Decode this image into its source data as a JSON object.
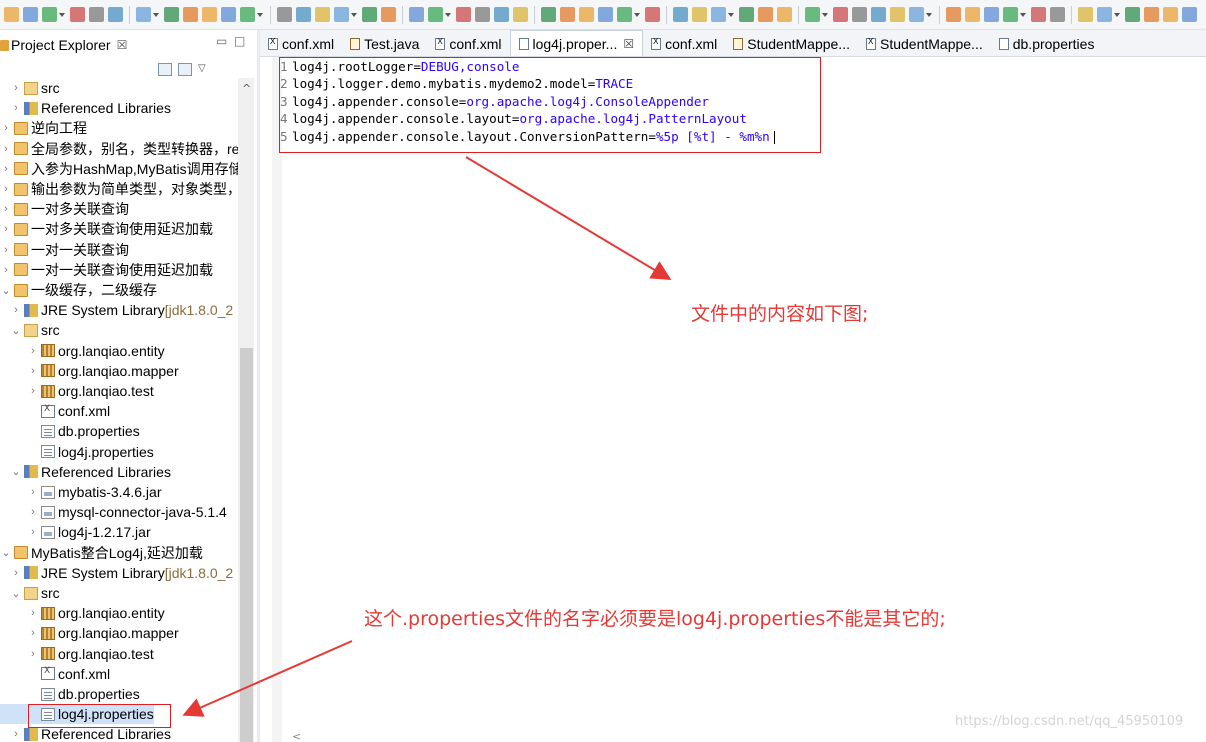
{
  "colors": {
    "annotation_red": "#e53935",
    "value_blue": "#2a00ff",
    "selection": "#ffffff"
  },
  "toolbar": {
    "icons": [
      "new-icon",
      "save-icon",
      "save-all-icon",
      "run-icon",
      "debug-icon",
      "search-icon",
      "perspective-icon"
    ]
  },
  "explorer": {
    "title": "Project Explorer",
    "close_glyph": "☒",
    "minimize_glyph": "▭",
    "maximize_glyph": "□",
    "tree": [
      {
        "label": "src",
        "indent": 1,
        "chev": ">",
        "icon": "src"
      },
      {
        "label": "Referenced Libraries",
        "indent": 1,
        "chev": ">",
        "icon": "lib"
      },
      {
        "label": "逆向工程",
        "indent": 0,
        "chev": ">",
        "icon": "proj"
      },
      {
        "label": "全局参数，别名，类型转换器，resu",
        "indent": 0,
        "chev": ">",
        "icon": "proj"
      },
      {
        "label": "入参为HashMap,MyBatis调用存储",
        "indent": 0,
        "chev": ">",
        "icon": "proj"
      },
      {
        "label": "输出参数为简单类型，对象类型，H",
        "indent": 0,
        "chev": ">",
        "icon": "proj"
      },
      {
        "label": "一对多关联查询",
        "indent": 0,
        "chev": ">",
        "icon": "proj"
      },
      {
        "label": "一对多关联查询使用延迟加载",
        "indent": 0,
        "chev": ">",
        "icon": "proj"
      },
      {
        "label": "一对一关联查询",
        "indent": 0,
        "chev": ">",
        "icon": "proj"
      },
      {
        "label": "一对一关联查询使用延迟加载",
        "indent": 0,
        "chev": ">",
        "icon": "proj"
      },
      {
        "label": "一级缓存，二级缓存",
        "indent": 0,
        "chev": "v",
        "icon": "proj"
      },
      {
        "label": "JRE System Library",
        "suffix": " [jdk1.8.0_2",
        "indent": 1,
        "chev": ">",
        "icon": "lib"
      },
      {
        "label": "src",
        "indent": 1,
        "chev": "v",
        "icon": "src"
      },
      {
        "label": "org.lanqiao.entity",
        "indent": 2,
        "chev": ">",
        "icon": "pkg"
      },
      {
        "label": "org.lanqiao.mapper",
        "indent": 2,
        "chev": ">",
        "icon": "pkg"
      },
      {
        "label": "org.lanqiao.test",
        "indent": 2,
        "chev": ">",
        "icon": "pkg"
      },
      {
        "label": "conf.xml",
        "indent": 2,
        "chev": "",
        "icon": "xml"
      },
      {
        "label": "db.properties",
        "indent": 2,
        "chev": "",
        "icon": "file"
      },
      {
        "label": "log4j.properties",
        "indent": 2,
        "chev": "",
        "icon": "file"
      },
      {
        "label": "Referenced Libraries",
        "indent": 1,
        "chev": "v",
        "icon": "lib"
      },
      {
        "label": "mybatis-3.4.6.jar",
        "indent": 2,
        "chev": ">",
        "icon": "jar"
      },
      {
        "label": "mysql-connector-java-5.1.4",
        "indent": 2,
        "chev": ">",
        "icon": "jar"
      },
      {
        "label": "log4j-1.2.17.jar",
        "indent": 2,
        "chev": ">",
        "icon": "jar"
      },
      {
        "label": "MyBatis整合Log4j,延迟加载",
        "indent": 0,
        "chev": "v",
        "icon": "proj"
      },
      {
        "label": "JRE System Library",
        "suffix": " [jdk1.8.0_2",
        "indent": 1,
        "chev": ">",
        "icon": "lib"
      },
      {
        "label": "src",
        "indent": 1,
        "chev": "v",
        "icon": "src"
      },
      {
        "label": "org.lanqiao.entity",
        "indent": 2,
        "chev": ">",
        "icon": "pkg"
      },
      {
        "label": "org.lanqiao.mapper",
        "indent": 2,
        "chev": ">",
        "icon": "pkg"
      },
      {
        "label": "org.lanqiao.test",
        "indent": 2,
        "chev": ">",
        "icon": "pkg"
      },
      {
        "label": "conf.xml",
        "indent": 2,
        "chev": "",
        "icon": "xml"
      },
      {
        "label": "db.properties",
        "indent": 2,
        "chev": "",
        "icon": "file"
      },
      {
        "label": "log4j.properties",
        "indent": 2,
        "chev": "",
        "icon": "file",
        "selected": true
      },
      {
        "label": "Referenced Libraries",
        "indent": 1,
        "chev": ">",
        "icon": "lib"
      }
    ]
  },
  "tabs": [
    {
      "label": "conf.xml",
      "icon": "x"
    },
    {
      "label": "Test.java",
      "icon": "j"
    },
    {
      "label": "conf.xml",
      "icon": "x"
    },
    {
      "label": "log4j.proper...",
      "icon": "f",
      "active": true,
      "close": "☒"
    },
    {
      "label": "conf.xml",
      "icon": "x"
    },
    {
      "label": "StudentMappe...",
      "icon": "j"
    },
    {
      "label": "StudentMappe...",
      "icon": "x"
    },
    {
      "label": "db.properties",
      "icon": "f"
    }
  ],
  "editor": {
    "lines": [
      {
        "num": "1",
        "key": "log4j.rootLogger=",
        "value": "DEBUG,console"
      },
      {
        "num": "2",
        "key": "log4j.logger.demo.mybatis.mydemo2.model=",
        "value": "TRACE"
      },
      {
        "num": "3",
        "key": "log4j.appender.console=",
        "value": "org.apache.log4j.ConsoleAppender"
      },
      {
        "num": "4",
        "key": "log4j.appender.console.layout=",
        "value": "org.apache.log4j.PatternLayout"
      },
      {
        "num": "5",
        "key": "log4j.appender.console.layout.ConversionPattern=",
        "value": "%5p [%t] - %m%n"
      }
    ]
  },
  "annotations": {
    "callout_1": "文件中的内容如下图;",
    "callout_2": "这个.properties文件的名字必须要是log4j.properties不能是其它的;"
  },
  "watermark": "https://blog.csdn.net/qq_45950109"
}
